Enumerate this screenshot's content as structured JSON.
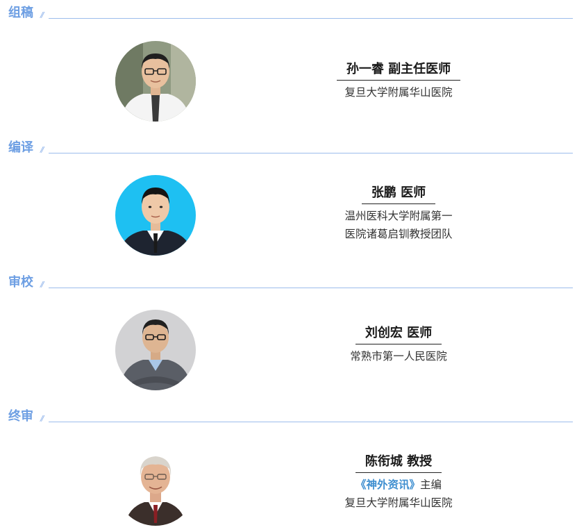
{
  "sections": [
    {
      "label": "组稿",
      "person": {
        "name": "孙一睿 副主任医师",
        "affiliation_lines": [
          "复旦大学附属华山医院"
        ]
      }
    },
    {
      "label": "编译",
      "person": {
        "name": "张鹏 医师",
        "affiliation_lines": [
          "温州医科大学附属第一",
          "医院诸葛启钏教授团队"
        ]
      }
    },
    {
      "label": "审校",
      "person": {
        "name": "刘创宏 医师",
        "affiliation_lines": [
          "常熟市第一人民医院"
        ]
      }
    },
    {
      "label": "终审",
      "person": {
        "name": "陈衔城 教授",
        "publication": "《神外资讯》",
        "role": "主编",
        "affiliation_lines": [
          "复旦大学附属华山医院"
        ]
      }
    }
  ],
  "divider_glyph": "//",
  "colors": {
    "section_label": "#6e9fe3",
    "divider": "#9cbcec",
    "publication_highlight": "#3f8fd0",
    "avatar2_background": "#1ec0f2"
  }
}
